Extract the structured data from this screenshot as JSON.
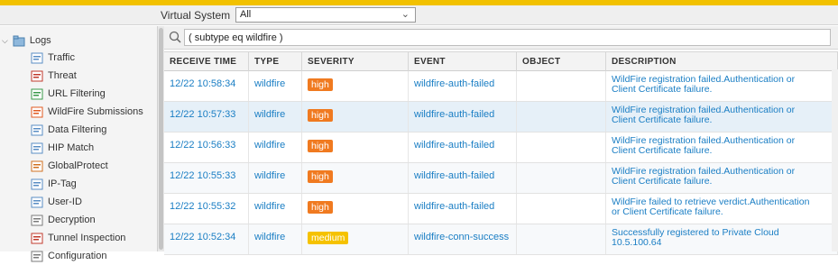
{
  "top": {
    "vs_label": "Virtual System",
    "vs_value": "All"
  },
  "sidebar": {
    "root": "Logs",
    "items": [
      {
        "label": "Traffic",
        "icon": "traffic-log-icon"
      },
      {
        "label": "Threat",
        "icon": "threat-log-icon"
      },
      {
        "label": "URL Filtering",
        "icon": "url-filtering-icon"
      },
      {
        "label": "WildFire Submissions",
        "icon": "wildfire-icon"
      },
      {
        "label": "Data Filtering",
        "icon": "data-filtering-icon"
      },
      {
        "label": "HIP Match",
        "icon": "hip-match-icon"
      },
      {
        "label": "GlobalProtect",
        "icon": "globalprotect-icon"
      },
      {
        "label": "IP-Tag",
        "icon": "ip-tag-icon"
      },
      {
        "label": "User-ID",
        "icon": "user-id-icon"
      },
      {
        "label": "Decryption",
        "icon": "decryption-icon"
      },
      {
        "label": "Tunnel Inspection",
        "icon": "tunnel-inspection-icon"
      },
      {
        "label": "Configuration",
        "icon": "configuration-icon"
      }
    ]
  },
  "filter": {
    "value": "( subtype eq wildfire )"
  },
  "table": {
    "headers": [
      "RECEIVE TIME",
      "TYPE",
      "SEVERITY",
      "EVENT",
      "OBJECT",
      "DESCRIPTION"
    ],
    "rows": [
      {
        "time": "12/22 10:58:34",
        "type": "wildfire",
        "severity": "high",
        "event": "wildfire-auth-failed",
        "object": "",
        "desc1": "WildFire registration failed.Authentication or",
        "desc2": "Client Certificate failure."
      },
      {
        "time": "12/22 10:57:33",
        "type": "wildfire",
        "severity": "high",
        "event": "wildfire-auth-failed",
        "object": "",
        "desc1": "WildFire registration failed.Authentication or",
        "desc2": "Client Certificate failure."
      },
      {
        "time": "12/22 10:56:33",
        "type": "wildfire",
        "severity": "high",
        "event": "wildfire-auth-failed",
        "object": "",
        "desc1": "WildFire registration failed.Authentication or",
        "desc2": "Client Certificate failure."
      },
      {
        "time": "12/22 10:55:33",
        "type": "wildfire",
        "severity": "high",
        "event": "wildfire-auth-failed",
        "object": "",
        "desc1": "WildFire registration failed.Authentication or",
        "desc2": "Client Certificate failure."
      },
      {
        "time": "12/22 10:55:32",
        "type": "wildfire",
        "severity": "high",
        "event": "wildfire-auth-failed",
        "object": "",
        "desc1": "WildFire failed to retrieve verdict.Authentication",
        "desc2": "or Client Certificate failure."
      },
      {
        "time": "12/22 10:52:34",
        "type": "wildfire",
        "severity": "medium",
        "event": "wildfire-conn-success",
        "object": "",
        "desc1": "Successfully registered to Private Cloud",
        "desc2": "10.5.100.64"
      }
    ]
  },
  "colors": {
    "accent_bar": "#f2c100",
    "link": "#1a7ec4",
    "high": "#f07a20",
    "medium": "#f5c200"
  }
}
